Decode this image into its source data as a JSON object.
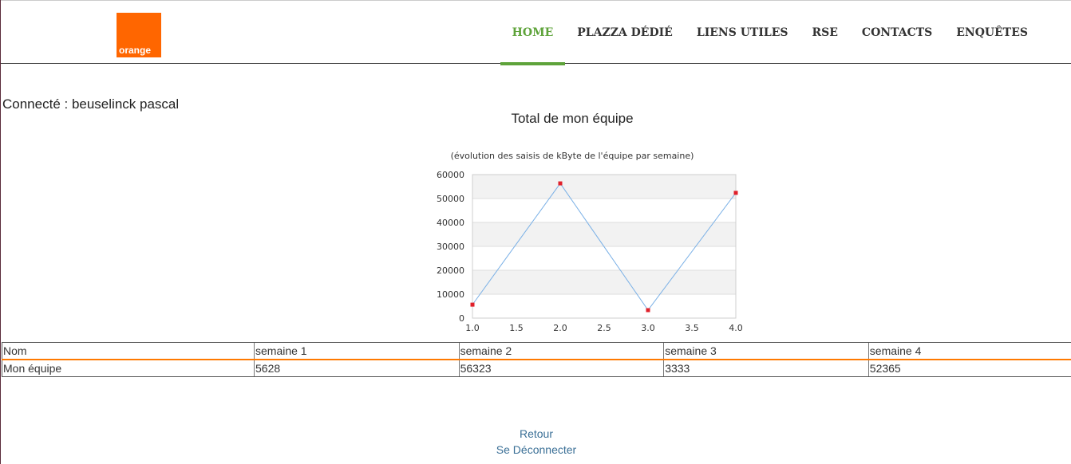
{
  "header": {
    "logo_text": "orange",
    "nav": [
      {
        "label": "HOME",
        "active": true
      },
      {
        "label": "PLAZZA DÉDIÉ",
        "active": false
      },
      {
        "label": "LIENS UTILES",
        "active": false
      },
      {
        "label": "RSE",
        "active": false
      },
      {
        "label": "CONTACTS",
        "active": false
      },
      {
        "label": "ENQUÊTES",
        "active": false
      }
    ]
  },
  "user": {
    "connected_text": "Connecté : beuselinck pascal"
  },
  "chart_data": {
    "type": "line",
    "title": "Total de mon équipe",
    "subtitle": "(évolution des saisis de kByte de l'équipe par semaine)",
    "x": [
      1,
      2,
      3,
      4
    ],
    "y": [
      5628,
      56323,
      3333,
      52365
    ],
    "xlim": [
      1.0,
      4.0
    ],
    "ylim": [
      0,
      60000
    ],
    "xticks": [
      "1.0",
      "1.5",
      "2.0",
      "2.5",
      "3.0",
      "3.5",
      "4.0"
    ],
    "yticks": [
      "0",
      "10000",
      "20000",
      "30000",
      "40000",
      "50000",
      "60000"
    ],
    "grid": true,
    "colors": {
      "line": "#7ab0e6",
      "marker": "#e0202a",
      "band": "#f2f2f2"
    }
  },
  "table": {
    "headers": [
      "Nom",
      "semaine 1",
      "semaine 2",
      "semaine 3",
      "semaine 4"
    ],
    "rows": [
      [
        "Mon équipe",
        "5628",
        "56323",
        "3333",
        "52365"
      ]
    ]
  },
  "links": {
    "back": "Retour",
    "logout": "Se Déconnecter"
  },
  "colors": {
    "brand": "#ff6600",
    "nav_active": "#5ea33a",
    "link": "#3a6f96",
    "table_accent": "#ff7900"
  }
}
